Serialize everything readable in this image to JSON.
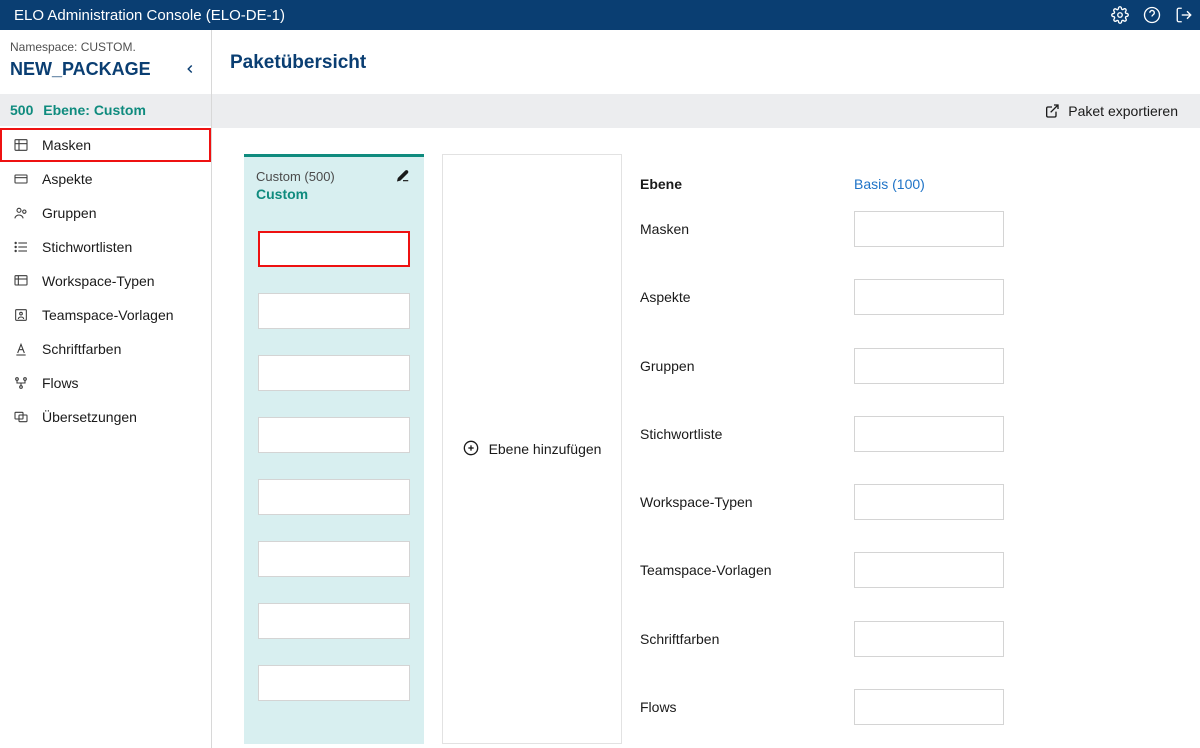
{
  "topbar": {
    "title": "ELO Administration Console (ELO-DE-1)"
  },
  "sidebar": {
    "namespace_label": "Namespace: CUSTOM.",
    "package_name": "NEW_PACKAGE",
    "level_number": "500",
    "level_label": "Ebene: Custom",
    "items": [
      {
        "id": "masken",
        "label": "Masken",
        "selected": true
      },
      {
        "id": "aspekte",
        "label": "Aspekte"
      },
      {
        "id": "gruppen",
        "label": "Gruppen"
      },
      {
        "id": "stichwortlisten",
        "label": "Stichwortlisten"
      },
      {
        "id": "workspace-typen",
        "label": "Workspace-Typen"
      },
      {
        "id": "teamspace-vorlagen",
        "label": "Teamspace-Vorlagen"
      },
      {
        "id": "schriftfarben",
        "label": "Schriftfarben"
      },
      {
        "id": "flows",
        "label": "Flows"
      },
      {
        "id": "uebersetzungen",
        "label": "Übersetzungen"
      }
    ]
  },
  "main": {
    "title": "Paketübersicht",
    "export_label": "Paket exportieren",
    "column_labels": {
      "ebene": "Ebene",
      "basis": "Basis (100)"
    },
    "custom_column": {
      "small": "Custom (500)",
      "name": "Custom"
    },
    "add_level_label": "Ebene hinzufügen",
    "rows": [
      "Masken",
      "Aspekte",
      "Gruppen",
      "Stichwortliste",
      "Workspace-Typen",
      "Teamspace-Vorlagen",
      "Schriftfarben",
      "Flows"
    ]
  }
}
